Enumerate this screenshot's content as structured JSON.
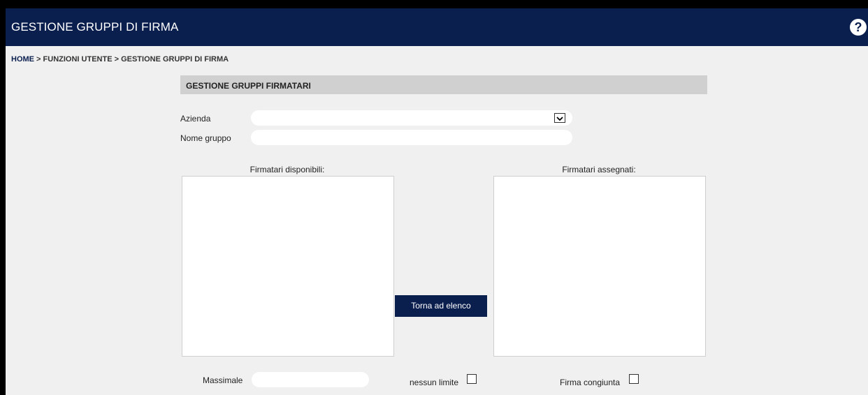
{
  "header": {
    "title": "GESTIONE GRUPPI DI FIRMA",
    "help_icon": "question-circle-icon"
  },
  "breadcrumb": {
    "home": "HOME",
    "rest": " > FUNZIONI UTENTE > GESTIONE GRUPPI DI FIRMA"
  },
  "form": {
    "section_title": "GESTIONE GRUPPI FIRMATARI",
    "azienda_label": "Azienda",
    "azienda_value": "",
    "nome_gruppo_label": "Nome gruppo",
    "nome_gruppo_value": "",
    "disponibili_label": "Firmatari disponibili:",
    "assegnati_label": "Firmatari assegnati:",
    "back_button": "Torna ad elenco",
    "massimale_label": "Massimale",
    "massimale_value": "",
    "nessun_limite_label": "nessun limite",
    "nessun_limite_checked": false,
    "firma_congiunta_label": "Firma congiunta",
    "firma_congiunta_checked": false
  },
  "colors": {
    "header": "#0b1f4f",
    "background": "#f0f0f0",
    "section_bar": "#d0d0d0"
  }
}
